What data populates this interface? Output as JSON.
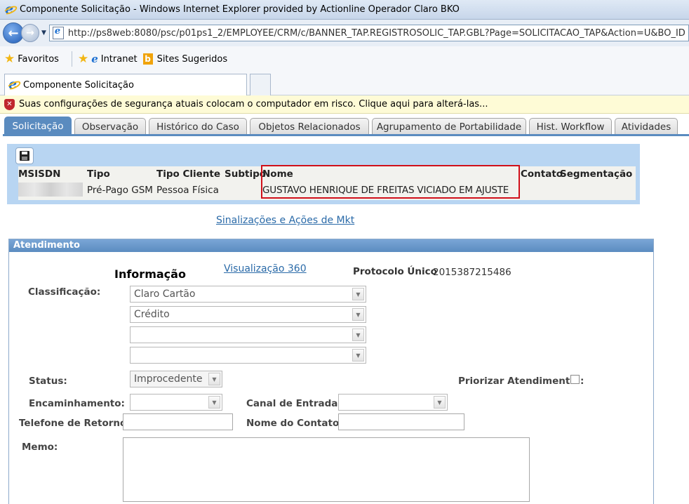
{
  "window": {
    "title": "Componente Solicitação - Windows Internet Explorer provided by Actionline Operador Claro BKO",
    "url": "http://ps8web:8080/psc/p01ps1_2/EMPLOYEE/CRM/c/BANNER_TAP.REGISTROSOLIC_TAP.GBL?Page=SOLICITACAO_TAP&Action=U&BO_ID"
  },
  "favorites": {
    "label": "Favoritos",
    "items": [
      "Intranet",
      "Sites Sugeridos"
    ]
  },
  "browser_tab": {
    "label": "Componente Solicitação"
  },
  "infobar": {
    "text": "Suas configurações de segurança atuais colocam o computador em risco. Clique aqui para alterá-las..."
  },
  "page_tabs": [
    "Solicitação",
    "Observação",
    "Histórico do Caso",
    "Objetos Relacionados",
    "Agrupamento de Portabilidade",
    "Hist. Workflow",
    "Atividades"
  ],
  "header": {
    "labels": {
      "msisdn": "MSISDN",
      "tipo": "Tipo",
      "tipo_cliente": "Tipo Cliente",
      "subtipo": "Subtipo",
      "nome": "Nome",
      "contato": "Contato",
      "segmentacao": "Segmentação"
    },
    "values": {
      "tipo": "Pré-Pago GSM",
      "tipo_cliente": "Pessoa Física",
      "nome": "GUSTAVO HENRIQUE DE FREITAS VICIADO EM AJUSTE"
    }
  },
  "links": {
    "mkt": "Sinalizações e Ações de Mkt"
  },
  "atendimento": {
    "section_title": "Atendimento",
    "informacao": "Informação",
    "visualizacao_link": "Visualização 360",
    "protocolo_label": "Protocolo Único",
    "protocolo_value": "2015387215486",
    "classificacao_label": "Classificação:",
    "classificacao": [
      "Claro Cartão",
      "Crédito",
      "",
      ""
    ],
    "status_label": "Status:",
    "status_value": "Improcedente",
    "priorizar_label": "Priorizar Atendimento::",
    "encaminhamento_label": "Encaminhamento:",
    "encaminhamento_value": "",
    "canal_label": "Canal de Entrada:",
    "canal_value": "",
    "telefone_label": "Telefone de Retorno:",
    "nome_contato_label": "Nome do Contato:",
    "memo_label": "Memo:"
  },
  "colors": {
    "tab_active": "#5a8bbf",
    "header_panel": "#b8d5f2",
    "highlight_box": "#d0101a",
    "link": "#2a6aa8"
  }
}
